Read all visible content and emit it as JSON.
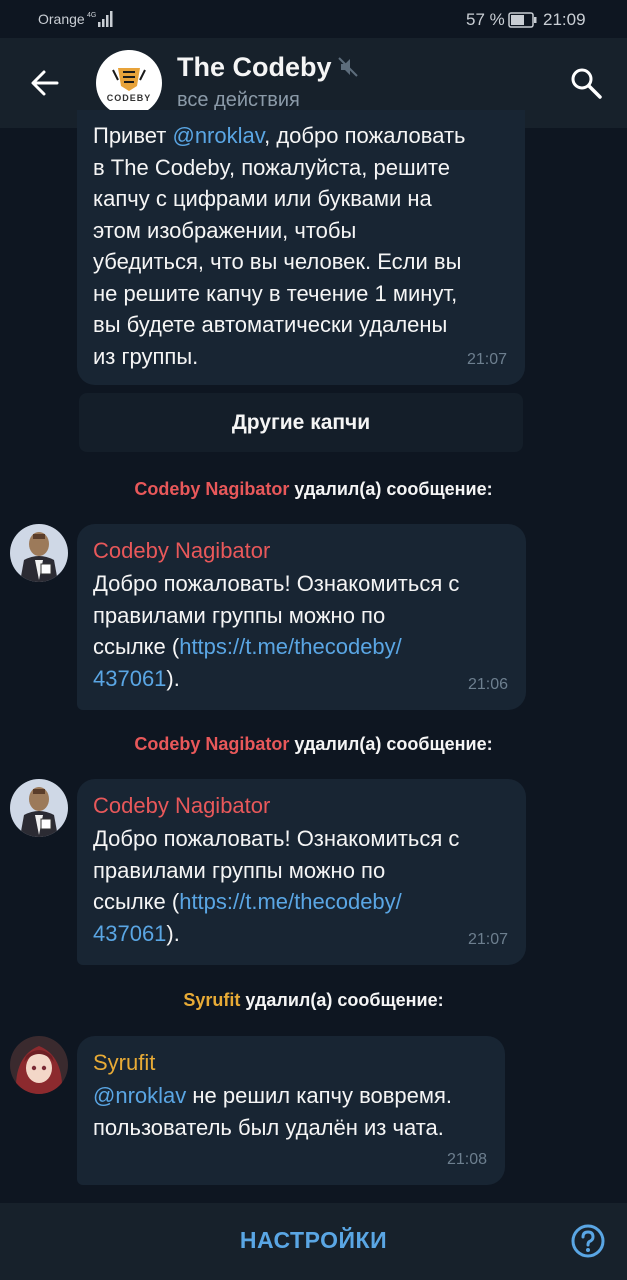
{
  "status_bar": {
    "carrier": "Orange",
    "battery_percent": "57 %",
    "time": "21:09"
  },
  "header": {
    "title": "The Codeby",
    "subtitle": "все действия",
    "logo_text": "CODEBY",
    "icons": [
      "back-arrow-icon",
      "mute-icon",
      "search-icon"
    ]
  },
  "messages": [
    {
      "kind": "bot",
      "text_before": "Привет ",
      "mention": "@nroklav",
      "text_after": ", добро пожаловать\nв The Codeby, пожалуйста, решите\nкапчу с цифрами или буквами на\nэтом изображении, чтобы\nубедиться, что вы человек. Если вы\nне решите капчу в течение 1 минут,\nвы будете автоматически удалены\nиз группы.",
      "time": "21:07",
      "button": "Другие капчи"
    },
    {
      "kind": "service",
      "actor": "Codeby Nagibator",
      "action": " удалил(а) сообщение:"
    },
    {
      "kind": "message",
      "sender": "Codeby Nagibator",
      "text_before": "Добро пожаловать! Ознакомиться с\nправилами группы можно по\nссылке (",
      "link": "https://t.me/thecodeby/\n437061",
      "text_after": ").",
      "time": "21:06"
    },
    {
      "kind": "service",
      "actor": "Codeby Nagibator",
      "action": " удалил(а) сообщение:"
    },
    {
      "kind": "message",
      "sender": "Codeby Nagibator",
      "text_before": "Добро пожаловать! Ознакомиться с\nправилами группы можно по\nссылке (",
      "link": "https://t.me/thecodeby/\n437061",
      "text_after": ").",
      "time": "21:07"
    },
    {
      "kind": "service",
      "actor": "Syrufit",
      "action": " удалил(а) сообщение:"
    },
    {
      "kind": "message",
      "sender": "Syrufit",
      "mention": "@nroklav",
      "text_after": " не решил капчу вовремя.\nпользователь был удалён из чата.",
      "time": "21:08"
    }
  ],
  "bottom_bar": {
    "settings_label": "НАСТРОЙКИ",
    "help_icon": "help-circle-icon"
  },
  "colors": {
    "background": "#0e1621",
    "header": "#17212b",
    "bubble": "#182533",
    "accent": "#5aa6e4",
    "nagibator_name": "#e8585a",
    "syrufit_name": "#e8ab36"
  }
}
